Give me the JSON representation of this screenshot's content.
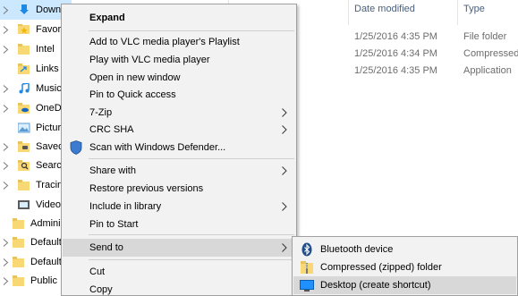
{
  "nav_tree": {
    "items": [
      {
        "label": "Downl"
      },
      {
        "label": "Favorit"
      },
      {
        "label": "Intel"
      },
      {
        "label": "Links"
      },
      {
        "label": "Music"
      },
      {
        "label": "OneDr"
      },
      {
        "label": "Picture"
      },
      {
        "label": "Saved"
      },
      {
        "label": "Search"
      },
      {
        "label": "Tracing"
      },
      {
        "label": "Videos"
      },
      {
        "label": "Adminis"
      },
      {
        "label": "Default"
      },
      {
        "label": "Default."
      },
      {
        "label": "Public"
      }
    ]
  },
  "file_list": {
    "columns": {
      "date_modified": "Date modified",
      "type": "Type"
    },
    "rows": [
      {
        "date": "1/25/2016 4:35 PM",
        "type": "File folder"
      },
      {
        "date": "1/25/2016 4:34 PM",
        "type": "Compressed"
      },
      {
        "date": "1/25/2016 4:35 PM",
        "type": "Application"
      }
    ]
  },
  "context_menu": {
    "items": [
      {
        "label": "Expand"
      },
      {
        "label": "Add to VLC media player's Playlist"
      },
      {
        "label": "Play with VLC media player"
      },
      {
        "label": "Open in new window"
      },
      {
        "label": "Pin to Quick access"
      },
      {
        "label": "7-Zip"
      },
      {
        "label": "CRC SHA"
      },
      {
        "label": "Scan with Windows Defender..."
      },
      {
        "label": "Share with"
      },
      {
        "label": "Restore previous versions"
      },
      {
        "label": "Include in library"
      },
      {
        "label": "Pin to Start"
      },
      {
        "label": "Send to"
      },
      {
        "label": "Cut"
      },
      {
        "label": "Copy"
      }
    ]
  },
  "send_to_menu": {
    "items": [
      {
        "label": "Bluetooth device",
        "icon": "bluetooth-icon"
      },
      {
        "label": "Compressed (zipped) folder",
        "icon": "zip-folder-icon"
      },
      {
        "label": "Desktop (create shortcut)",
        "icon": "desktop-icon"
      }
    ]
  },
  "colors": {
    "menu_bg": "#f2f2f2",
    "menu_hover": "#d8d8d8",
    "folder_yellow": "#f8d775",
    "header_text": "#4c607a",
    "bluetooth_blue": "#1f4e8c",
    "desktop_blue": "#1e90ff"
  }
}
